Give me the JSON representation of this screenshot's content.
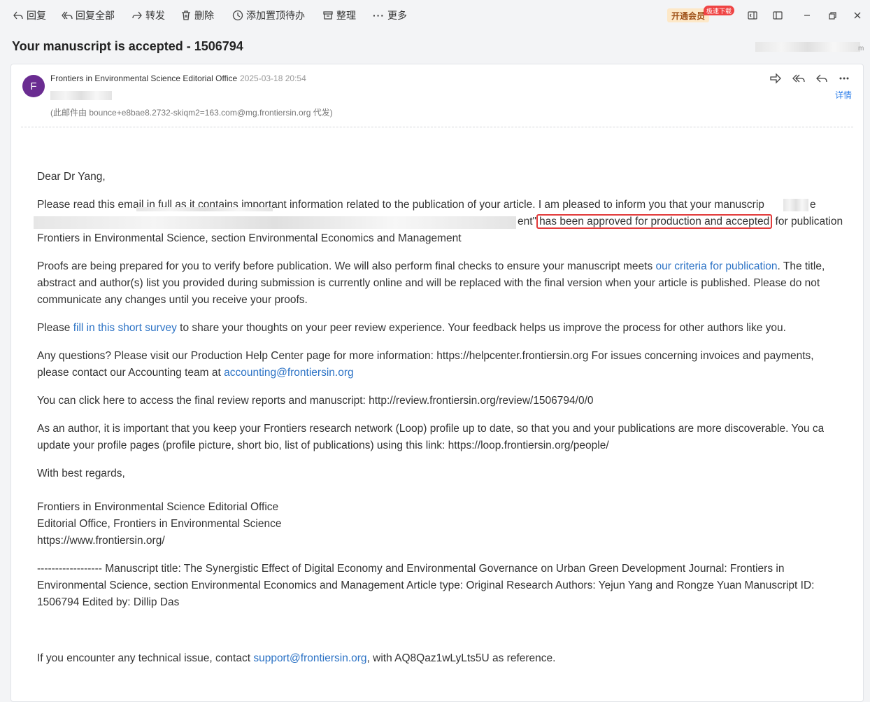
{
  "toolbar": {
    "reply": "回复",
    "reply_all": "回复全部",
    "forward": "转发",
    "delete": "删除",
    "add_todo": "添加置顶待办",
    "organize": "整理",
    "more": "更多",
    "vip": "开通会员",
    "vip_badge": "极速下载"
  },
  "email": {
    "subject": "Your manuscript is accepted - 1506794",
    "sender": "Frontiers in Environmental Science Editorial Office",
    "time": "2025-03-18 20:54",
    "avatar_letter": "F",
    "proxy_note": "(此邮件由 bounce+e8bae8.2732-skiqm2=163.com@mg.frontiersin.org 代发)",
    "detail": "详情"
  },
  "body": {
    "greeting": "Dear Dr Yang,",
    "p1_l1": "Please read this email in full as it contains important information related to the publication of your article. I am pleased to inform you that your manuscrip",
    "p1_l1_tail": "e",
    "p1_l2_pre": "ent\"",
    "p1_highlight": "has been approved for production and accepted",
    "p1_l2_post": " for publication",
    "p1_l3": "Frontiers in Environmental Science, section Environmental Economics and Management",
    "p2_l1_pre": "Proofs are being prepared for you to verify before publication. We will also perform final checks to ensure your manuscript meets ",
    "p2_l1_link": "our criteria for publication",
    "p2_l1_post": ". The title,",
    "p2_l2": "abstract and author(s) list you provided during submission is currently online and will be replaced with the final version when your article is published. Please do not",
    "p2_l3": "communicate any changes until you receive your proofs.",
    "p3_pre": "Please ",
    "p3_link": "fill in this short survey",
    "p3_post": " to share your thoughts on your peer review experience. Your feedback helps us improve the process for other authors like you.",
    "p4_l1": "Any questions? Please visit our Production Help Center page for more information: https://helpcenter.frontiersin.org For issues concerning invoices and payments,",
    "p4_l2_pre": "please contact our Accounting team at ",
    "p4_l2_link": "accounting@frontiersin.org",
    "p5": "You can click here to access the final review reports and manuscript: http://review.frontiersin.org/review/1506794/0/0",
    "p6_l1": "As an author, it is important that you keep your Frontiers research network (Loop) profile up to date, so that you and your publications are more discoverable. You ca",
    "p6_l2": "update your profile pages (profile picture, short bio, list of publications) using this link: https://loop.frontiersin.org/people/",
    "regards": "With best regards,",
    "sig1": "Frontiers in Environmental Science Editorial Office",
    "sig2": "Editorial Office, Frontiers in Environmental Science",
    "sig3": "https://www.frontiersin.org/",
    "meta_l1": "------------------ Manuscript title: The Synergistic Effect of Digital Economy and Environmental Governance on Urban Green Development Journal: Frontiers in",
    "meta_l2": "Environmental Science, section Environmental Economics and Management Article type: Original Research Authors: Yejun Yang and Rongze Yuan Manuscript ID:",
    "meta_l3": "1506794 Edited by: Dillip Das",
    "footer_pre": "If you encounter any technical issue, contact ",
    "footer_link": "support@frontiersin.org",
    "footer_post": ", with AQ8Qaz1wLyLts5U as reference."
  },
  "colors": {
    "link": "#2b72c5",
    "highlight_border": "#e23b3b",
    "avatar": "#6a2c91"
  }
}
